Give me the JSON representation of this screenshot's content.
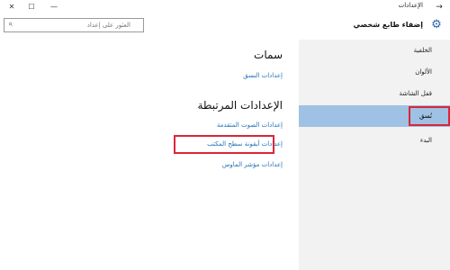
{
  "titlebar": {
    "title": "الإعدادات"
  },
  "header": {
    "title": "إضفاء طابع شخصي"
  },
  "search": {
    "placeholder": "العثور على إعداد"
  },
  "sidebar": {
    "items": [
      {
        "label": "الخلفية"
      },
      {
        "label": "الألوان"
      },
      {
        "label": "قفل الشاشة"
      },
      {
        "label": "نُسق"
      },
      {
        "label": "البدء"
      }
    ]
  },
  "main": {
    "section1_title": "سمات",
    "theme_settings_link": "إعدادات النسق",
    "section2_title": "الإعدادات المرتبطة",
    "related_links": [
      {
        "label": "إعدادات الصوت المتقدمة"
      },
      {
        "label": "إعدادات أيقونة سطح المكتب"
      },
      {
        "label": "إعدادات مؤشر الماوس"
      }
    ]
  },
  "colors": {
    "accent": "#9fc1e3",
    "link": "#1f6fb6",
    "highlight": "#d9263a"
  }
}
